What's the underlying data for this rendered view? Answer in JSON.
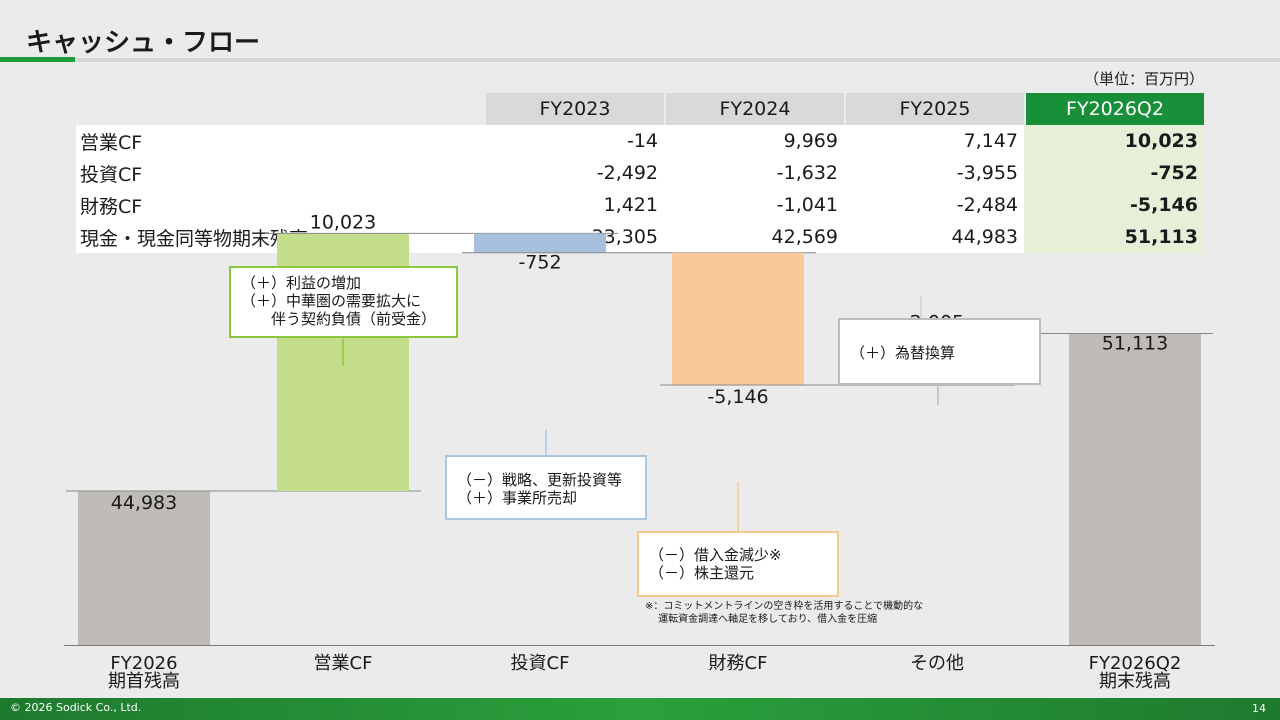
{
  "title": "キャッシュ・フロー",
  "unit": "（単位：百万円）",
  "table": {
    "headers": [
      "FY2023",
      "FY2024",
      "FY2025",
      "FY2026Q2"
    ],
    "rows": [
      {
        "label": "営業CF",
        "values": [
          "-14",
          "9,969",
          "7,147",
          "10,023"
        ]
      },
      {
        "label": "投資CF",
        "values": [
          "-2,492",
          "-1,632",
          "-3,955",
          "-752"
        ]
      },
      {
        "label": "財務CF",
        "values": [
          "1,421",
          "-1,041",
          "-2,484",
          "-5,146"
        ]
      },
      {
        "label": "現金・現金同等物期末残高",
        "values": [
          "33,305",
          "42,569",
          "44,983",
          "51,113"
        ]
      }
    ]
  },
  "chart_data": {
    "type": "bar",
    "subtype": "waterfall",
    "categories": [
      "FY2026\n期首残高",
      "営業CF",
      "投資CF",
      "財務CF",
      "その他",
      "FY2026Q2\n期末残高"
    ],
    "values": [
      44983,
      10023,
      -752,
      -5146,
      2005,
      51113
    ],
    "labels": [
      "44,983",
      "10,023",
      "-752",
      "-5,146",
      "2,005",
      "51,113"
    ],
    "colors": [
      "#bfbcb7",
      "#c3dd8a",
      "#a6bfdc",
      "#f8c896",
      "#dcdcdc",
      "#bfbcb7"
    ]
  },
  "callouts": {
    "operating": "（＋）利益の増加\n（＋）中華圏の需要拡大に\n　　伴う契約負債（前受金）",
    "investing": "（－）戦略、更新投資等\n（＋）事業所売却",
    "financing": "（－）借入金減少※\n（－）株主還元",
    "other": "（＋）為替換算"
  },
  "note": "※：コミットメントラインの空き枠を活用することで機動的な\n　 運転資金調達へ軸足を移しており、借入金を圧縮",
  "footer": {
    "copyright": "© 2026 Sodick Co., Ltd.",
    "page": "14"
  }
}
